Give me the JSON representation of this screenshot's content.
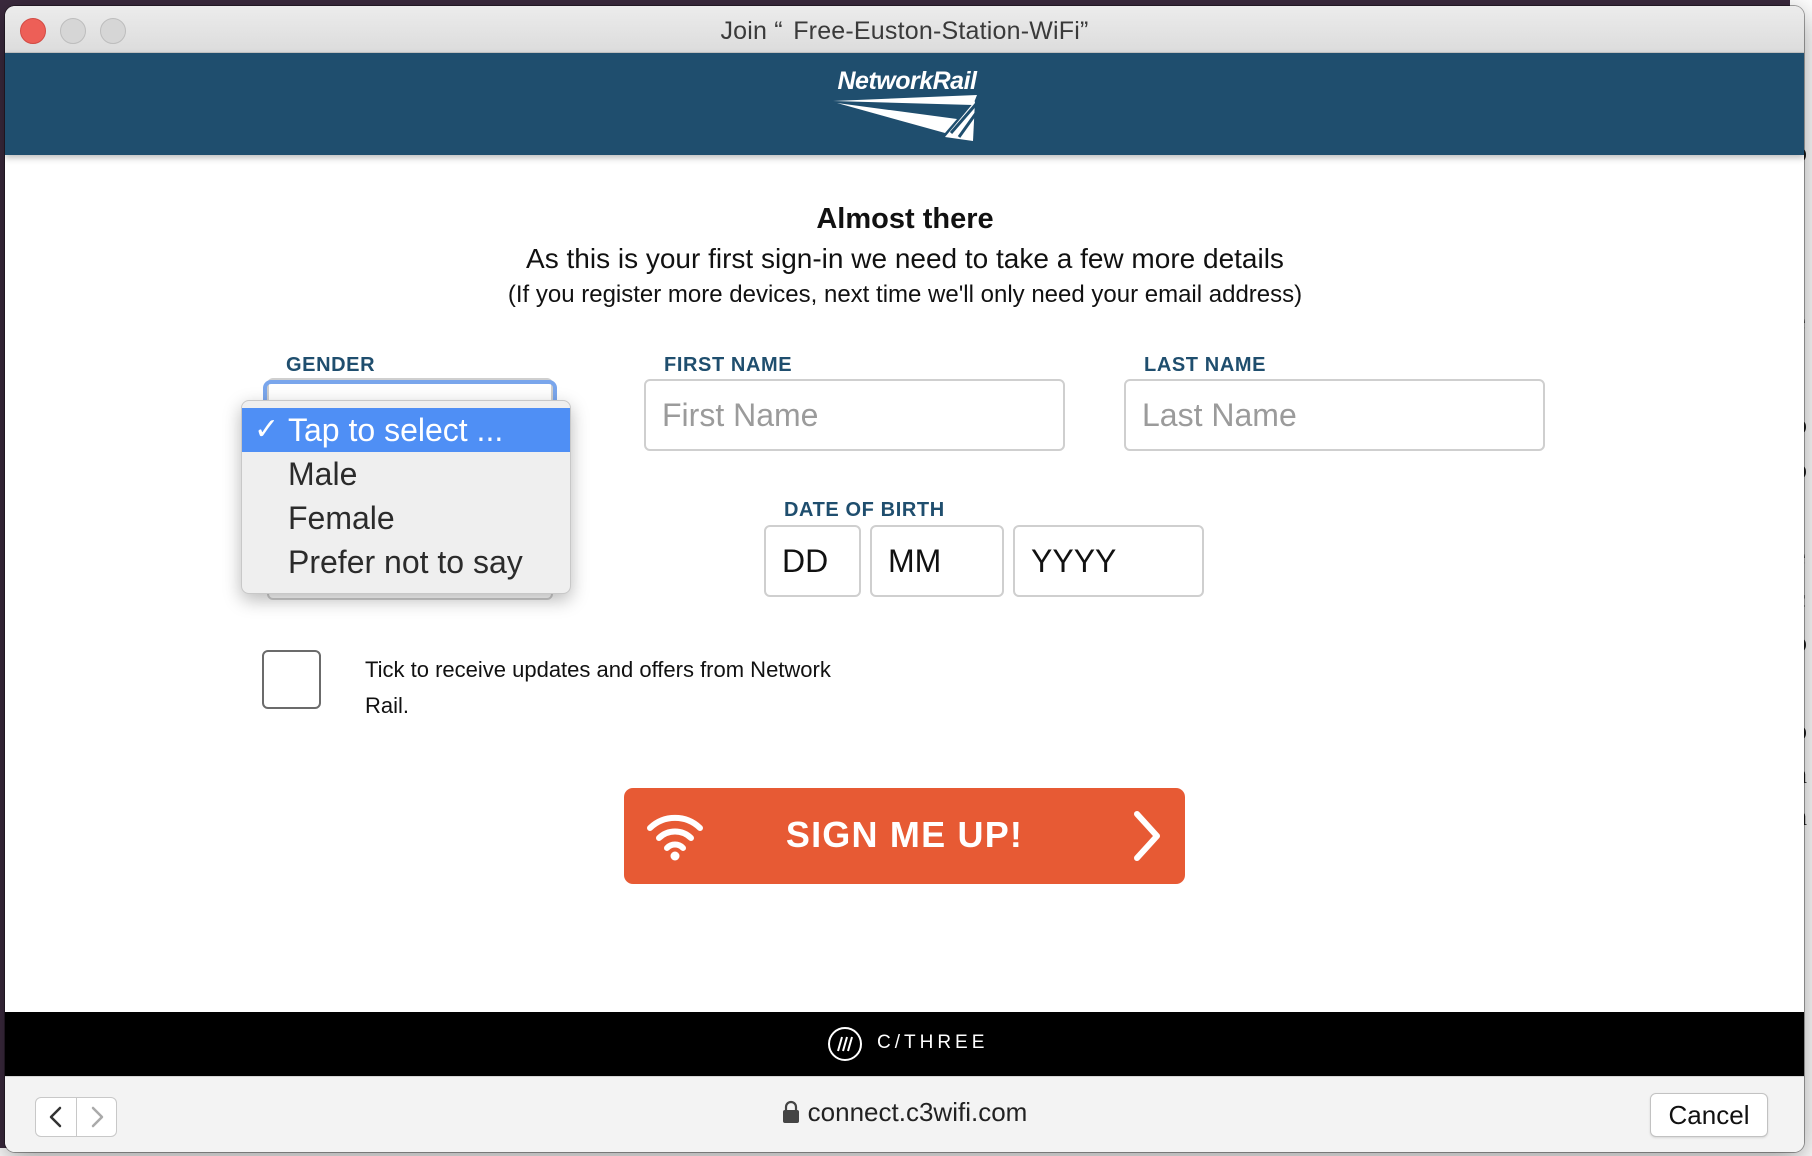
{
  "window": {
    "title": "Join “  Free-Euston-Station-WiFi”"
  },
  "header": {
    "logo_text": "NetworkRail",
    "background_color": "#1f4e6e"
  },
  "intro": {
    "heading": "Almost there",
    "subheading": "As this is your first sign-in we need to take a few more details",
    "note": "(If you register more devices, next time we'll only need your email address)"
  },
  "form": {
    "gender": {
      "label": "GENDER",
      "options": [
        "Tap to select ...",
        "Male",
        "Female",
        "Prefer not to say"
      ],
      "selected_index": 0,
      "checkmark": "✓"
    },
    "first_name": {
      "label": "FIRST NAME",
      "placeholder": "First Name",
      "value": ""
    },
    "last_name": {
      "label": "LAST NAME",
      "placeholder": "Last Name",
      "value": ""
    },
    "dob": {
      "label": "DATE OF BIRTH",
      "day": "DD",
      "month": "MM",
      "year": "YYYY"
    },
    "updates_checkbox": {
      "checked": false,
      "label": "Tick to receive updates and offers from Network Rail."
    },
    "submit": {
      "label": "SIGN ME UP!",
      "color": "#e75a34",
      "left_icon": "wifi-icon",
      "right_icon": "chevron-right-icon"
    }
  },
  "footer": {
    "brand": "C/THREE"
  },
  "bottom_bar": {
    "url": "connect.c3wifi.com",
    "cancel_label": "Cancel"
  }
}
